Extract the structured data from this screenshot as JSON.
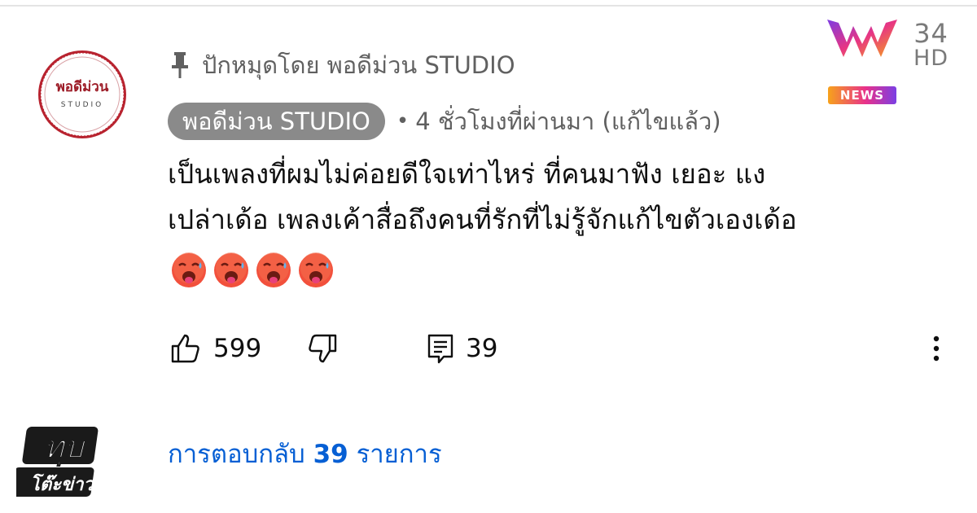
{
  "pinned": {
    "label": "ปักหมุดโดย พอดีม่วน STUDIO"
  },
  "avatar": {
    "logo_text": "พอดีม่วน",
    "logo_subtext": "STUDIO"
  },
  "author": {
    "name": "พอดีม่วน STUDIO",
    "separator": "•",
    "meta": "4 ชั่วโมงที่ผ่านมา (แก้ไขแล้ว)"
  },
  "comment": {
    "lines": [
      "เป็นเพลงที่ผมไม่ค่อยดีใจเท่าไหร่ ที่คนมาฟัง เยอะ แง",
      "เปล่าเด้อ เพลงเค้าสื่อถึงคนที่รักที่ไม่รู้จักแก้ไขตัวเองเด้อ"
    ],
    "emoji": [
      "hot-face-emoji",
      "hot-face-emoji",
      "hot-face-emoji",
      "hot-face-emoji"
    ]
  },
  "actions": {
    "like_count": "599",
    "reply_count": "39"
  },
  "channel": {
    "number": "34",
    "quality": "HD",
    "badge": "NEWS"
  },
  "replies": {
    "prefix": "การตอบกลับ",
    "count": "39",
    "suffix": "รายการ"
  },
  "bottom_logo": {
    "text_top": "ทุบ",
    "text_bottom": "โต๊ะข่าว"
  },
  "colors": {
    "link": "#065fd4",
    "chip": "#8a8a8a",
    "muted": "#606060",
    "avatar_red": "#b8232f"
  }
}
